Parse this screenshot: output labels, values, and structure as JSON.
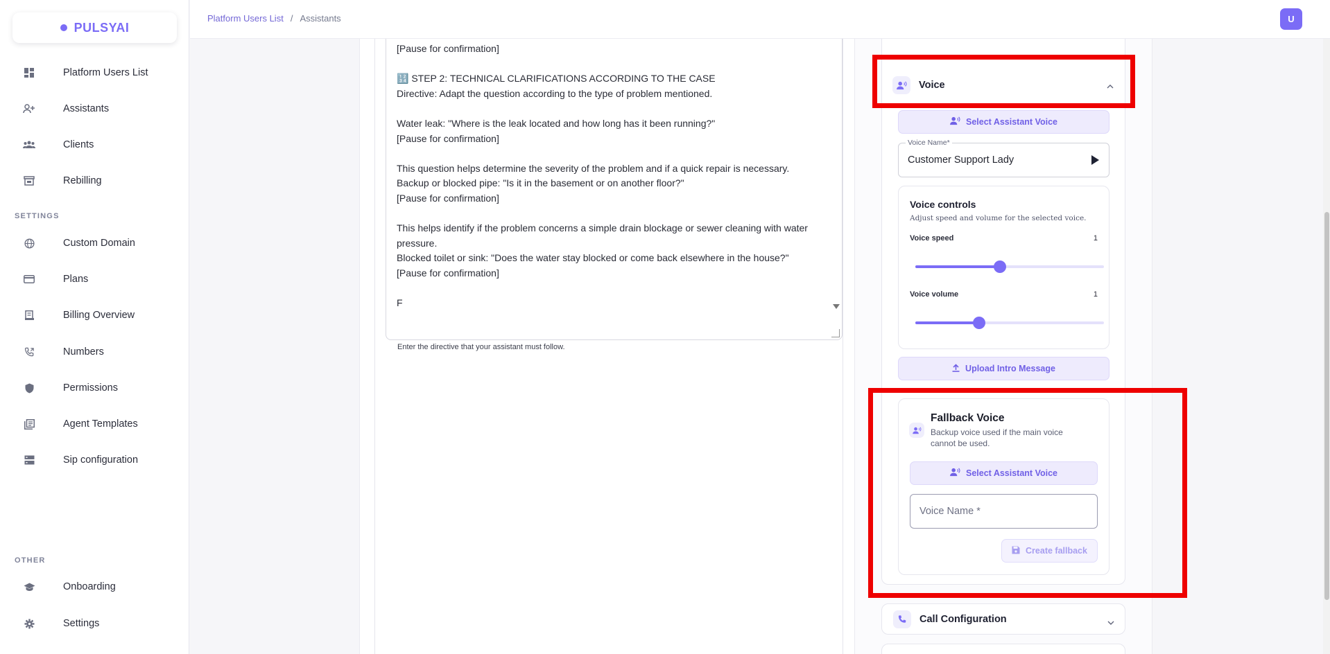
{
  "app": {
    "logo_text": "PULSYAI"
  },
  "colors": {
    "brand": "#7b6cf6",
    "highlight": "#ee0000"
  },
  "sidebar": {
    "items": [
      {
        "label": "Platform Users List",
        "icon": "dashboard-icon"
      },
      {
        "label": "Assistants",
        "icon": "person-add-icon"
      },
      {
        "label": "Clients",
        "icon": "group-icon"
      },
      {
        "label": "Rebilling",
        "icon": "store-icon"
      }
    ],
    "settings_label": "SETTINGS",
    "settings_items": [
      {
        "label": "Custom Domain",
        "icon": "globe-icon"
      },
      {
        "label": "Plans",
        "icon": "credit-card-icon"
      },
      {
        "label": "Billing Overview",
        "icon": "receipt-icon"
      },
      {
        "label": "Numbers",
        "icon": "phone-forward-icon"
      },
      {
        "label": "Permissions",
        "icon": "shield-icon"
      },
      {
        "label": "Agent Templates",
        "icon": "library-books-icon"
      },
      {
        "label": "Sip configuration",
        "icon": "server-icon"
      }
    ],
    "other_label": "OTHER",
    "other_items": [
      {
        "label": "Onboarding",
        "icon": "graduation-cap-icon"
      },
      {
        "label": "Settings",
        "icon": "gear-icon"
      }
    ]
  },
  "topbar": {
    "breadcrumb_root": "Platform Users List",
    "breadcrumb_sep": "/",
    "breadcrumb_current": "Assistants",
    "avatar_initial": "U"
  },
  "directive": {
    "text": "[Pause for confirmation]\n\n🔢 STEP 2: TECHNICAL CLARIFICATIONS ACCORDING TO THE CASE\nDirective: Adapt the question according to the type of problem mentioned.\n\nWater leak: \"Where is the leak located and how long has it been running?\"\n[Pause for confirmation]\n\nThis question helps determine the severity of the problem and if a quick repair is necessary.\nBackup or blocked pipe: \"Is it in the basement or on another floor?\"\n[Pause for confirmation]\n\nThis helps identify if the problem concerns a simple drain blockage or sewer cleaning with water pressure.\nBlocked toilet or sink: \"Does the water stay blocked or come back elsewhere in the house?\"\n[Pause for confirmation]\n\nF",
    "hint": "Enter the directive that your assistant must follow."
  },
  "voice": {
    "section_title": "Voice",
    "select_button": "Select Assistant Voice",
    "voice_name_label": "Voice Name*",
    "voice_name_value": "Customer Support Lady",
    "controls_title": "Voice controls",
    "controls_subtitle": "Adjust speed and volume for the selected voice.",
    "speed_label": "Voice speed",
    "speed_value": "1",
    "speed_fraction": 0.45,
    "volume_label": "Voice volume",
    "volume_value": "1",
    "volume_fraction": 0.34,
    "upload_button": "Upload Intro Message"
  },
  "fallback": {
    "title": "Fallback Voice",
    "subtitle_line1": "Backup voice used if the main voice",
    "subtitle_line2": "cannot be used.",
    "select_button": "Select Assistant Voice",
    "voice_name_placeholder": "Voice Name *",
    "create_button": "Create fallback"
  },
  "call_config": {
    "title": "Call Configuration"
  }
}
